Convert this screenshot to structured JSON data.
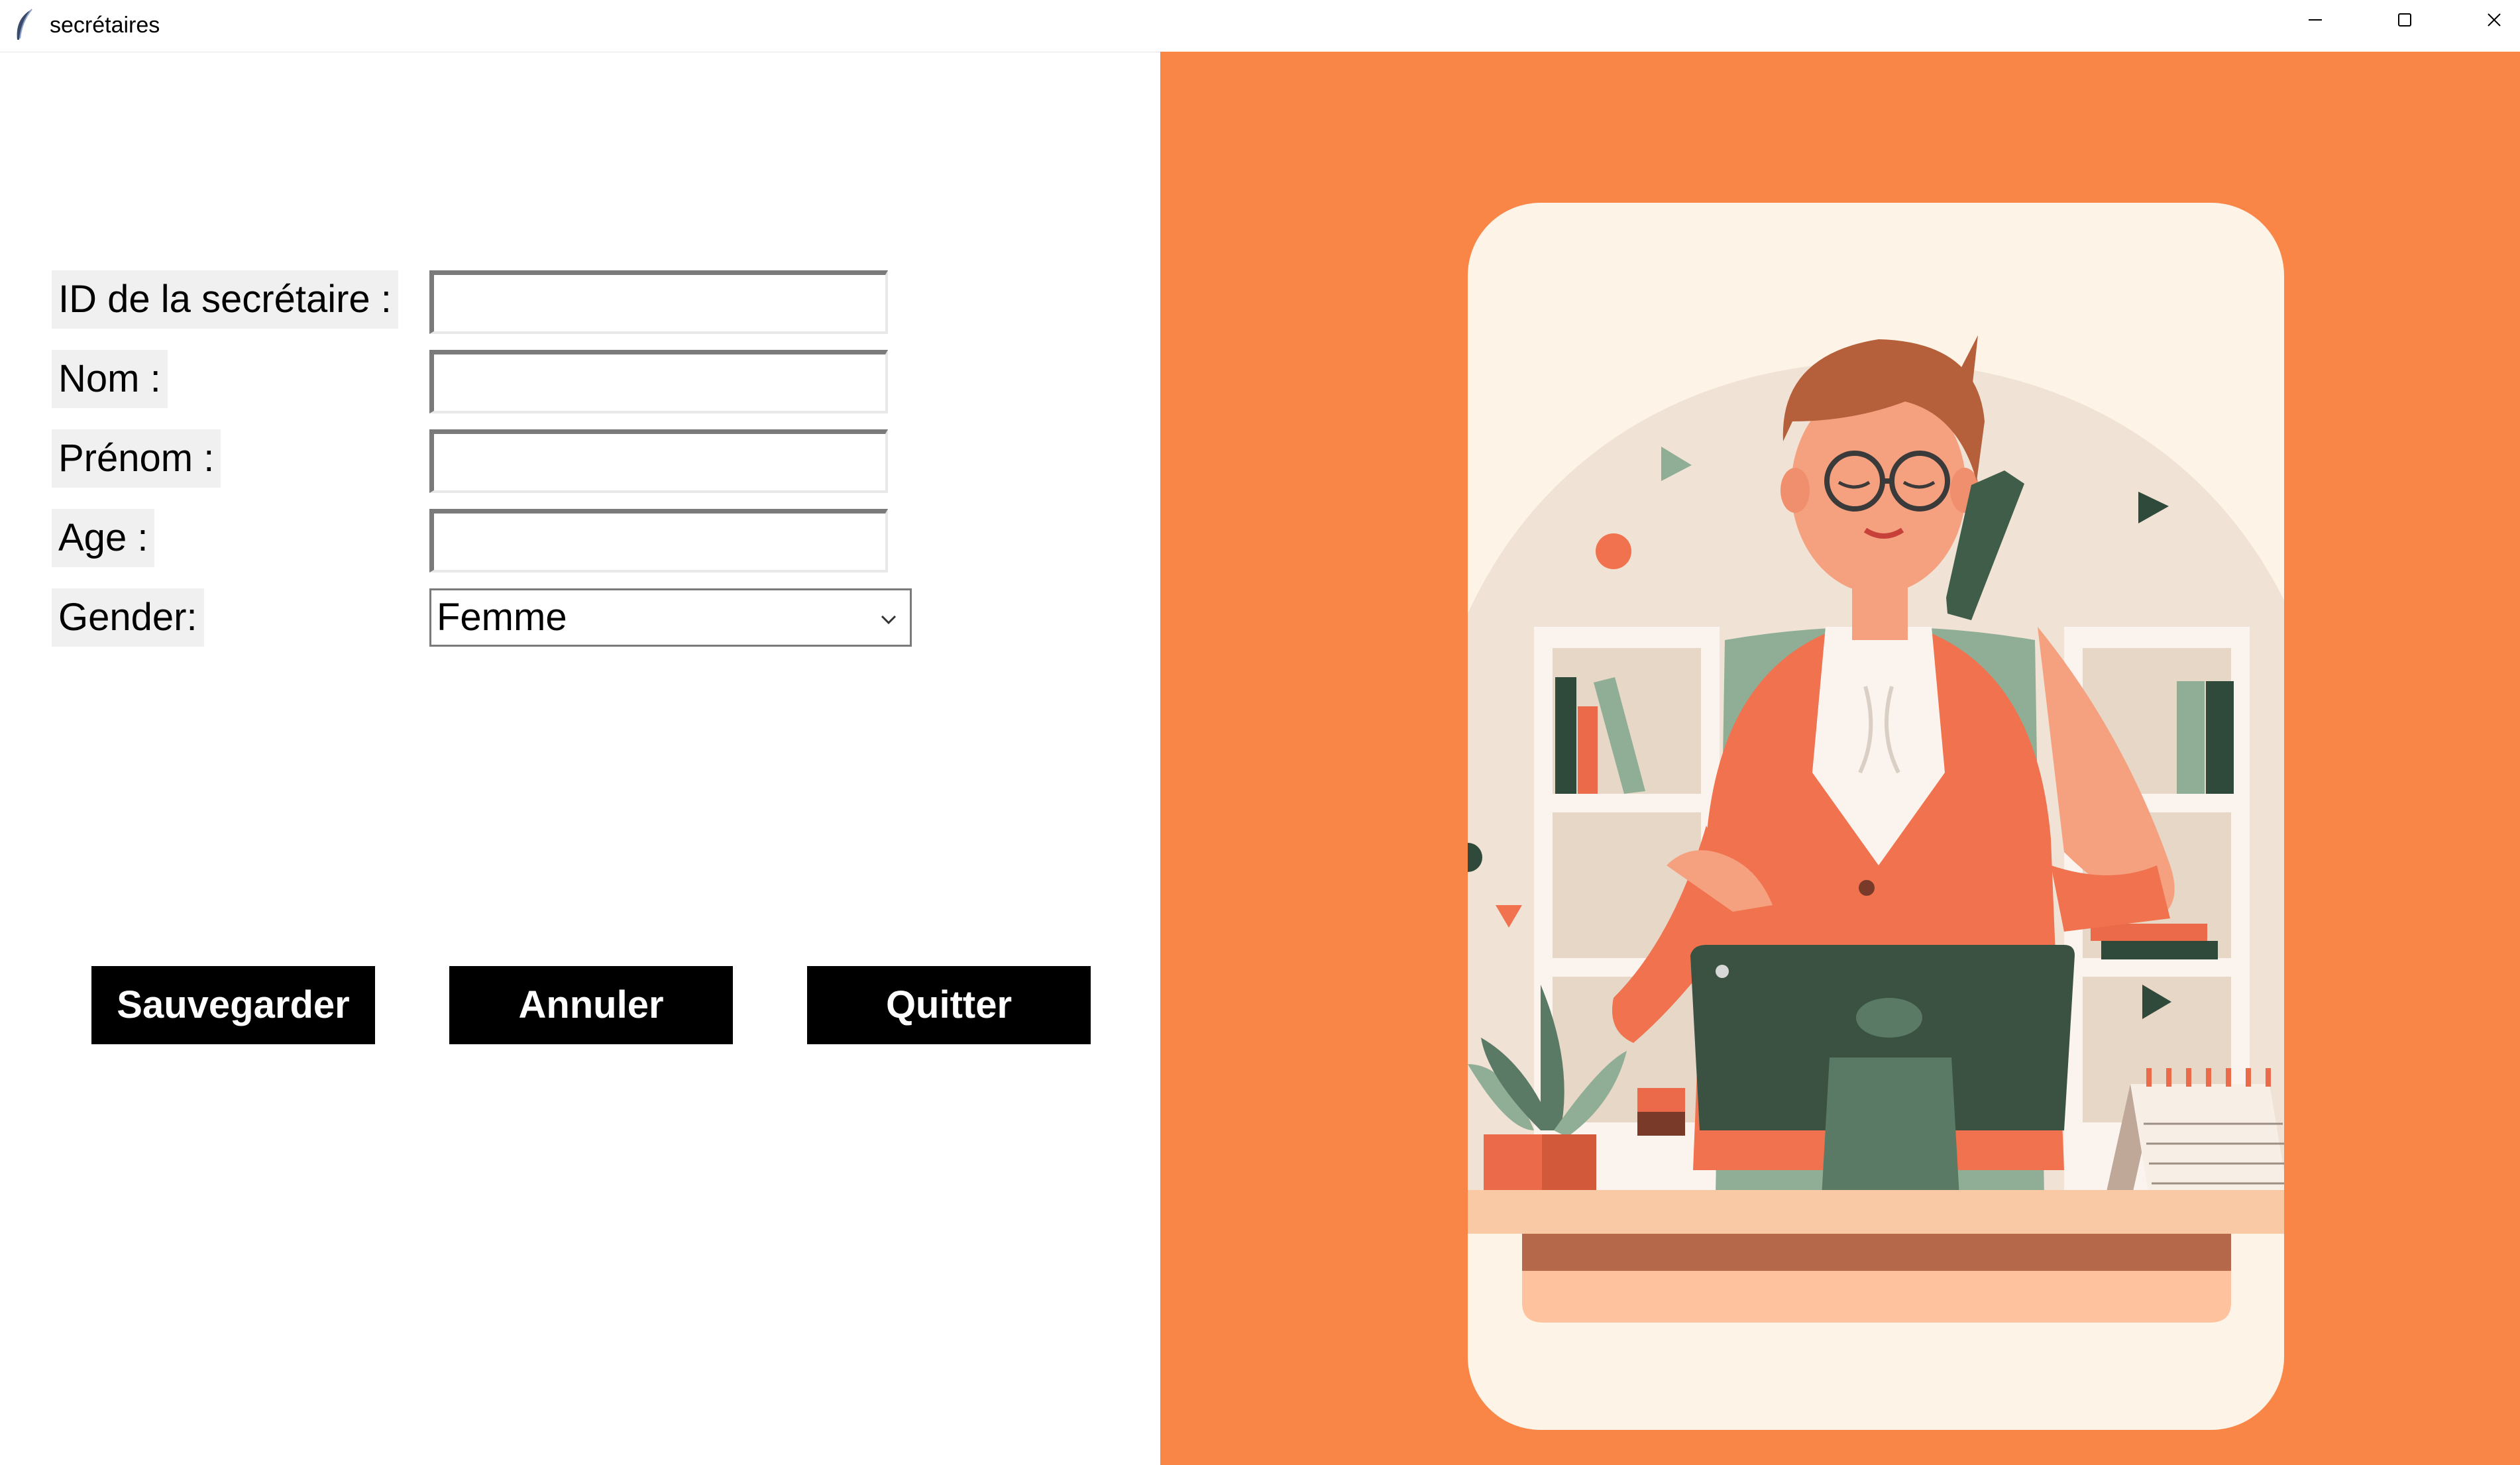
{
  "window": {
    "title": "secrétaires",
    "icon": "feather-icon",
    "controls": [
      "minimize-icon",
      "maximize-icon",
      "close-icon"
    ]
  },
  "form": {
    "fields": [
      {
        "label": "ID de la secrétaire :",
        "value": ""
      },
      {
        "label": "Nom :",
        "value": ""
      },
      {
        "label": "Prénom :",
        "value": ""
      },
      {
        "label": "Age :",
        "value": ""
      }
    ],
    "gender": {
      "label": "Gender:",
      "selected": "Femme"
    }
  },
  "actions": {
    "save_label": "Sauvegarder",
    "cancel_label": "Annuler",
    "quit_label": "Quitter"
  },
  "colors": {
    "accent_orange": "#f98646",
    "button_bg": "#000000",
    "label_bg": "#f0f0f0",
    "card_bg": "#fdf3e6"
  }
}
